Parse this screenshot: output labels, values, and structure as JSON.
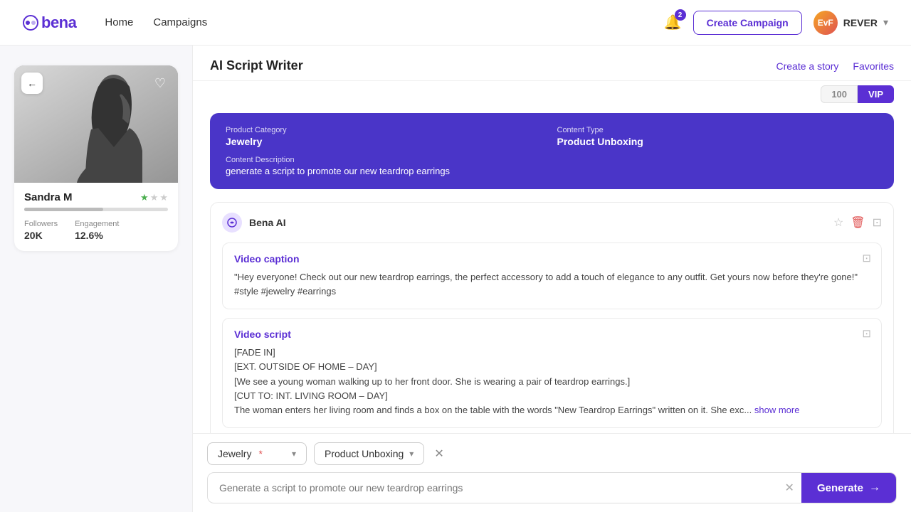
{
  "navbar": {
    "logo": "bena",
    "links": [
      "Home",
      "Campaigns"
    ],
    "bell_badge": "2",
    "create_campaign": "Create Campaign",
    "user": {
      "initials": "EvF",
      "name": "REVER"
    }
  },
  "tabs": {
    "tab1": "100",
    "tab2": "VIP"
  },
  "script_writer": {
    "title": "AI Script Writer",
    "action1": "Create a story",
    "action2": "Favorites"
  },
  "info_card": {
    "product_category_label": "Product Category",
    "product_category_value": "Jewelry",
    "content_type_label": "Content Type",
    "content_type_value": "Product Unboxing",
    "content_description_label": "Content Description",
    "content_description_value": "generate a script to promote our new teardrop earrings"
  },
  "ai_response": {
    "sender": "Bena AI",
    "video_caption": {
      "label": "Video caption",
      "text": "\"Hey everyone! Check out our new teardrop earrings, the perfect accessory to add a touch of elegance to any outfit. Get yours now before they're gone!\" #style #jewelry #earrings"
    },
    "video_script": {
      "label": "Video script",
      "lines": [
        "[FADE IN]",
        "[EXT. OUTSIDE OF HOME – DAY]",
        "[We see a young woman walking up to her front door. She is wearing a pair of teardrop earrings.]",
        "[CUT TO: INT. LIVING ROOM – DAY]",
        "The woman enters her living room and finds a box on the table with the words \"New Teardrop Earrings\" written on it. She exc..."
      ],
      "show_more": "show more"
    }
  },
  "influencer": {
    "name": "Sandra M",
    "followers_label": "Followers",
    "followers_value": "20K",
    "engagement_label": "Engagement",
    "engagement_value": "12.6%",
    "stars": 1
  },
  "bottom": {
    "dropdown1_label": "Jewelry",
    "dropdown1_req": "*",
    "dropdown2_label": "Product Unboxing",
    "input_placeholder": "Generate a script to promote our new teardrop earrings",
    "generate_label": "Generate"
  }
}
